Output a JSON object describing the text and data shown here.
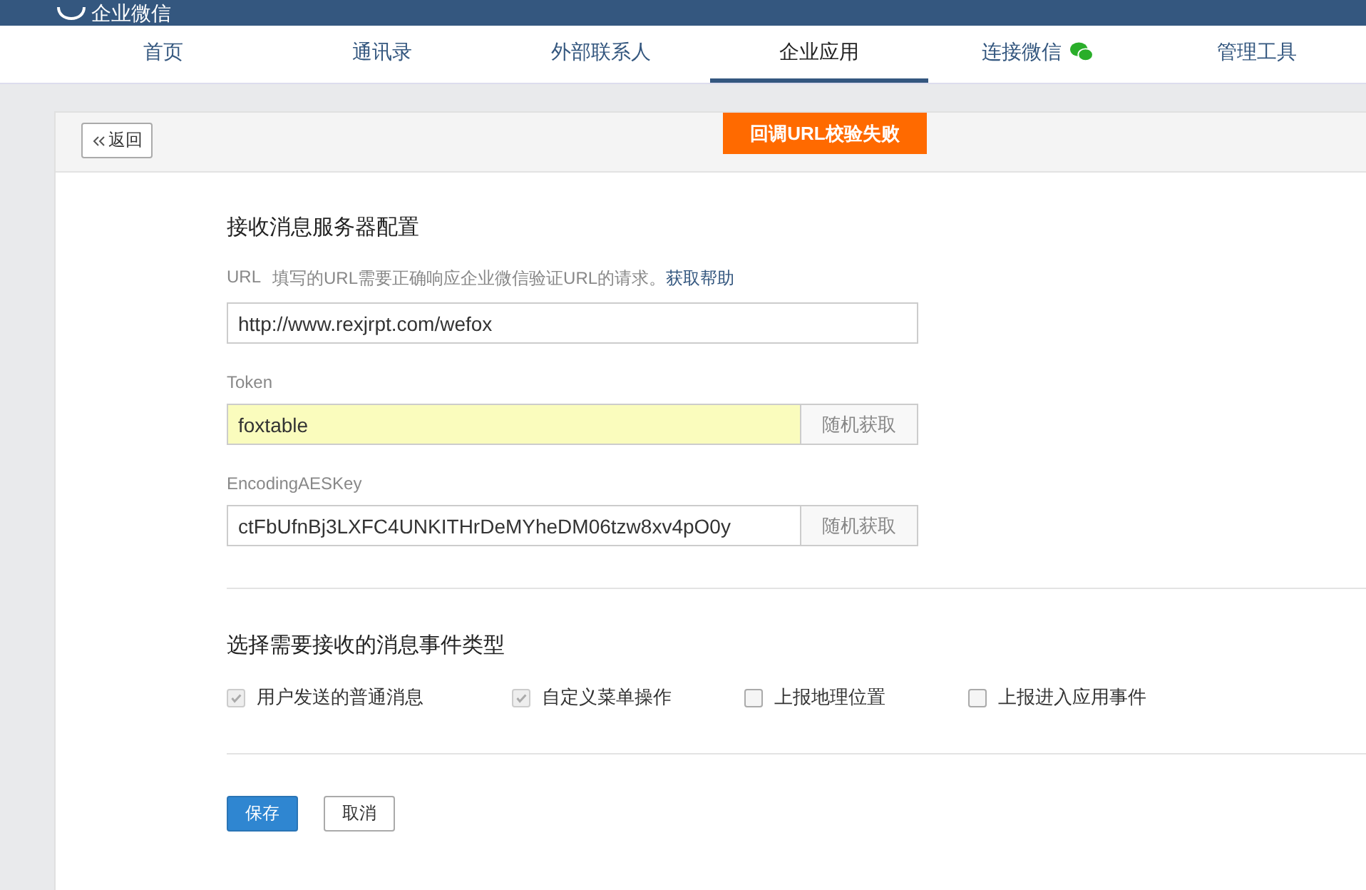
{
  "header": {
    "brand": "企业微信"
  },
  "nav": [
    {
      "label": "首页",
      "selected": false
    },
    {
      "label": "通讯录",
      "selected": false
    },
    {
      "label": "外部联系人",
      "selected": false
    },
    {
      "label": "企业应用",
      "selected": true
    },
    {
      "label": "连接微信",
      "selected": false,
      "kind": "wechat"
    },
    {
      "label": "管理工具",
      "selected": false
    }
  ],
  "toolbar": {
    "back": "返回",
    "alert": "回调URL校验失败"
  },
  "server_config": {
    "title": "接收消息服务器配置",
    "url": {
      "label": "URL",
      "hint": "填写的URL需要正确响应企业微信验证URL的请求。",
      "help_link": "获取帮助",
      "value": "http://www.rexjrpt.com/wefox"
    },
    "token": {
      "label": "Token",
      "value": "foxtable",
      "highlighted": true,
      "button": "随机获取"
    },
    "aes_key": {
      "label": "EncodingAESKey",
      "value": "ctFbUfnBj3LXFC4UNKITHrDeMYheDM06tzw8xv4pO0y",
      "highlighted": false,
      "button": "随机获取"
    }
  },
  "events": {
    "title": "选择需要接收的消息事件类型",
    "options": [
      {
        "label": "用户发送的普通消息",
        "checked": true
      },
      {
        "label": "自定义菜单操作",
        "checked": true
      },
      {
        "label": "上报地理位置",
        "checked": false
      },
      {
        "label": "上报进入应用事件",
        "checked": false
      }
    ]
  },
  "buttons": {
    "save": "保存",
    "cancel": "取消"
  }
}
